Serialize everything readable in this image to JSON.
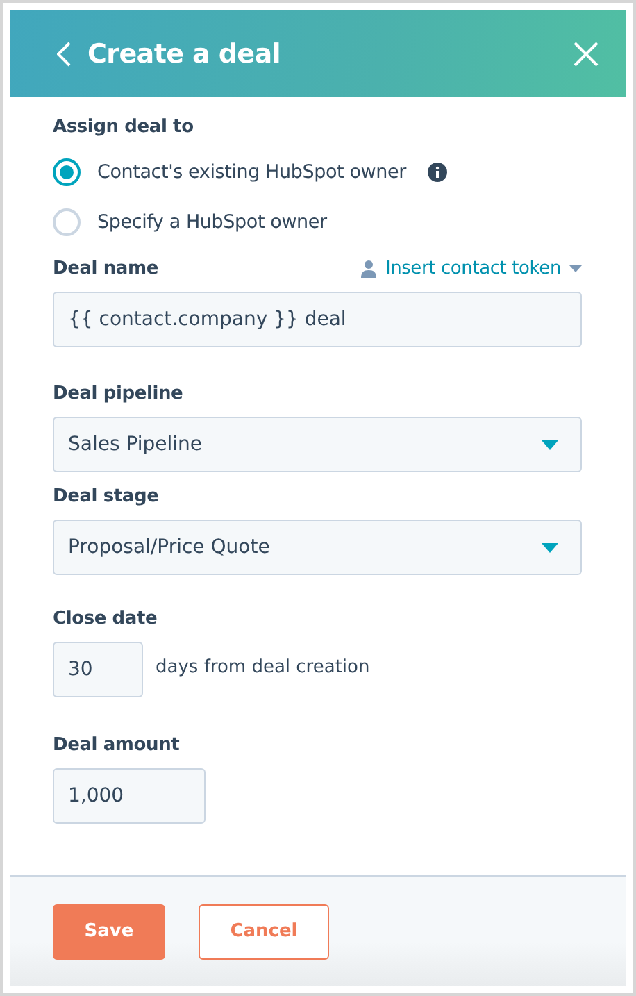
{
  "header": {
    "title": "Create a deal"
  },
  "assign": {
    "label": "Assign deal to",
    "options": [
      {
        "label": "Contact's existing HubSpot owner",
        "selected": true,
        "info": true
      },
      {
        "label": "Specify a HubSpot owner",
        "selected": false,
        "info": false
      }
    ]
  },
  "deal_name": {
    "label": "Deal name",
    "token_link": "Insert contact token",
    "value": "{{ contact.company }} deal"
  },
  "deal_pipeline": {
    "label": "Deal pipeline",
    "value": "Sales Pipeline"
  },
  "deal_stage": {
    "label": "Deal stage",
    "value": "Proposal/Price Quote"
  },
  "close_date": {
    "label": "Close date",
    "value": "30",
    "suffix": "days from deal creation"
  },
  "deal_amount": {
    "label": "Deal amount",
    "value": "1,000"
  },
  "buttons": [
    {
      "label": "Save",
      "kind": "primary"
    },
    {
      "label": "Cancel",
      "kind": "secondary"
    }
  ]
}
